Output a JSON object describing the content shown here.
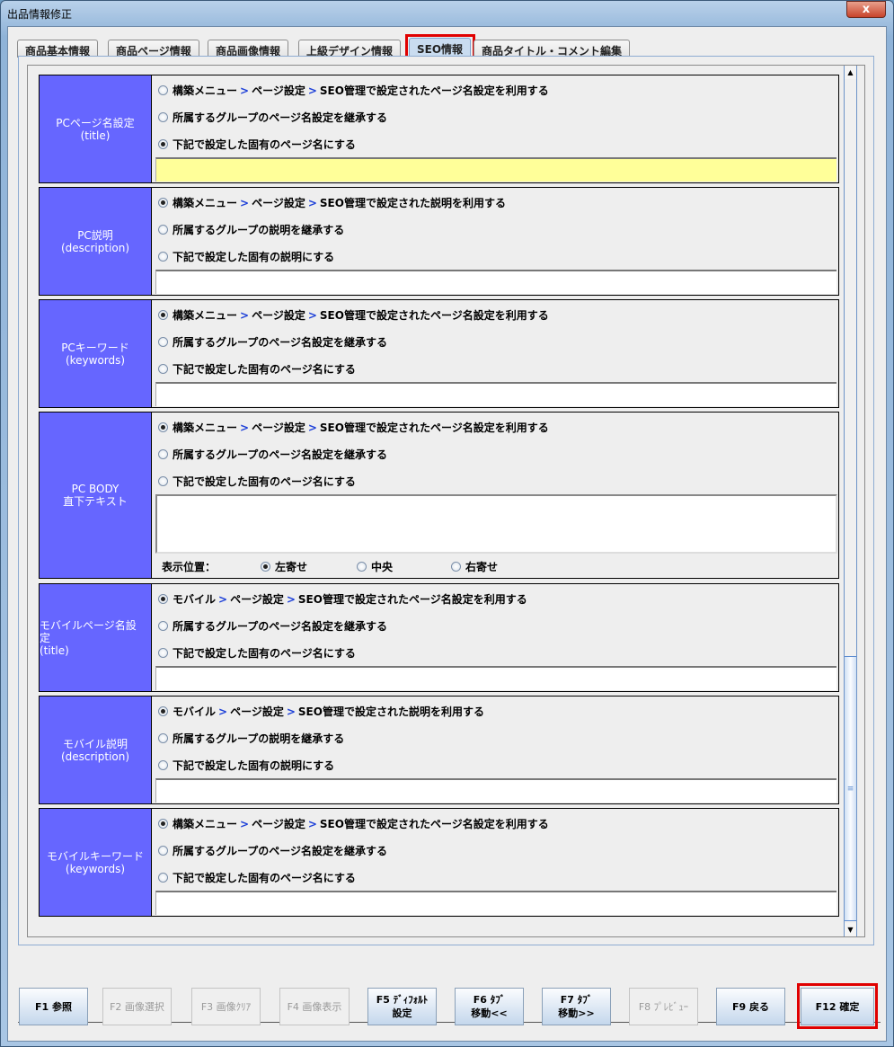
{
  "window": {
    "title": "出品情報修正",
    "close_label": "x"
  },
  "tabs": [
    "商品基本情報",
    "商品ページ情報",
    "商品画像情報",
    "上級デザイン情報",
    "SEO情報",
    "商品タイトル・コメント編集"
  ],
  "active_tab": "SEO情報",
  "accent_color": "#6666ff",
  "sections": [
    {
      "label1": "PCページ名設定",
      "label2": "(title)",
      "options": [
        {
          "a": "構築メニュー",
          "b": "ページ設定",
          "c": "SEO管理で設定されたページ名設定を利用する"
        },
        {
          "t": "所属するグループのページ名設定を継承する"
        },
        {
          "t": "下記で設定した固有のページ名にする"
        }
      ],
      "selected": 2,
      "value": ""
    },
    {
      "label1": "PC説明",
      "label2": "(description)",
      "options": [
        {
          "a": "構築メニュー",
          "b": "ページ設定",
          "c": "SEO管理で設定された説明を利用する"
        },
        {
          "t": "所属するグループの説明を継承する"
        },
        {
          "t": "下記で設定した固有の説明にする"
        }
      ],
      "selected": 0,
      "value": ""
    },
    {
      "label1": "PCキーワード",
      "label2": "(keywords)",
      "options": [
        {
          "a": "構築メニュー",
          "b": "ページ設定",
          "c": "SEO管理で設定されたページ名設定を利用する"
        },
        {
          "t": "所属するグループのページ名設定を継承する"
        },
        {
          "t": "下記で設定した固有のページ名にする"
        }
      ],
      "selected": 0,
      "value": ""
    },
    {
      "label1": "PC BODY",
      "label2": "直下テキスト",
      "options": [
        {
          "a": "構築メニュー",
          "b": "ページ設定",
          "c": "SEO管理で設定されたページ名設定を利用する"
        },
        {
          "t": "所属するグループのページ名設定を継承する"
        },
        {
          "t": "下記で設定した固有のページ名にする"
        }
      ],
      "selected": 0,
      "value": "",
      "position_label": "表示位置：",
      "positions": [
        "左寄せ",
        "中央",
        "右寄せ"
      ],
      "position_selected": 0
    },
    {
      "label1": "モバイルページ名設定",
      "label2": "(title)",
      "options": [
        {
          "a": "モバイル",
          "b": "ページ設定",
          "c": "SEO管理で設定されたページ名設定を利用する"
        },
        {
          "t": "所属するグループのページ名設定を継承する"
        },
        {
          "t": "下記で設定した固有のページ名にする"
        }
      ],
      "selected": 0,
      "value": ""
    },
    {
      "label1": "モバイル説明",
      "label2": "(description)",
      "options": [
        {
          "a": "モバイル",
          "b": "ページ設定",
          "c": "SEO管理で設定された説明を利用する"
        },
        {
          "t": "所属するグループの説明を継承する"
        },
        {
          "t": "下記で設定した固有の説明にする"
        }
      ],
      "selected": 0,
      "value": ""
    },
    {
      "label1": "モバイルキーワード",
      "label2": "(keywords)",
      "options": [
        {
          "a": "構築メニュー",
          "b": "ページ設定",
          "c": "SEO管理で設定されたページ名設定を利用する"
        },
        {
          "t": "所属するグループのページ名設定を継承する"
        },
        {
          "t": "下記で設定した固有のページ名にする"
        }
      ],
      "selected": 0,
      "value": ""
    }
  ],
  "separator": ">",
  "scroll_position_fraction": 1.0,
  "buttons": [
    {
      "label": "F1 参照",
      "enabled": true
    },
    {
      "label": "F2 画像選択",
      "enabled": false
    },
    {
      "label": "F3 画像ｸﾘｱ",
      "enabled": false
    },
    {
      "label": "F4 画像表示",
      "enabled": false
    },
    {
      "label": "F5 ﾃﾞｨﾌｫﾙﾄ\n設定",
      "enabled": true
    },
    {
      "label": "F6 ﾀﾌﾞ\n移動<<",
      "enabled": true
    },
    {
      "label": "F7 ﾀﾌﾞ\n移動>>",
      "enabled": true
    },
    {
      "label": "F8 ﾌﾟﾚﾋﾞｭｰ",
      "enabled": false
    },
    {
      "label": "F9 戻る",
      "enabled": true
    },
    {
      "label": "F12 確定",
      "enabled": true
    }
  ]
}
